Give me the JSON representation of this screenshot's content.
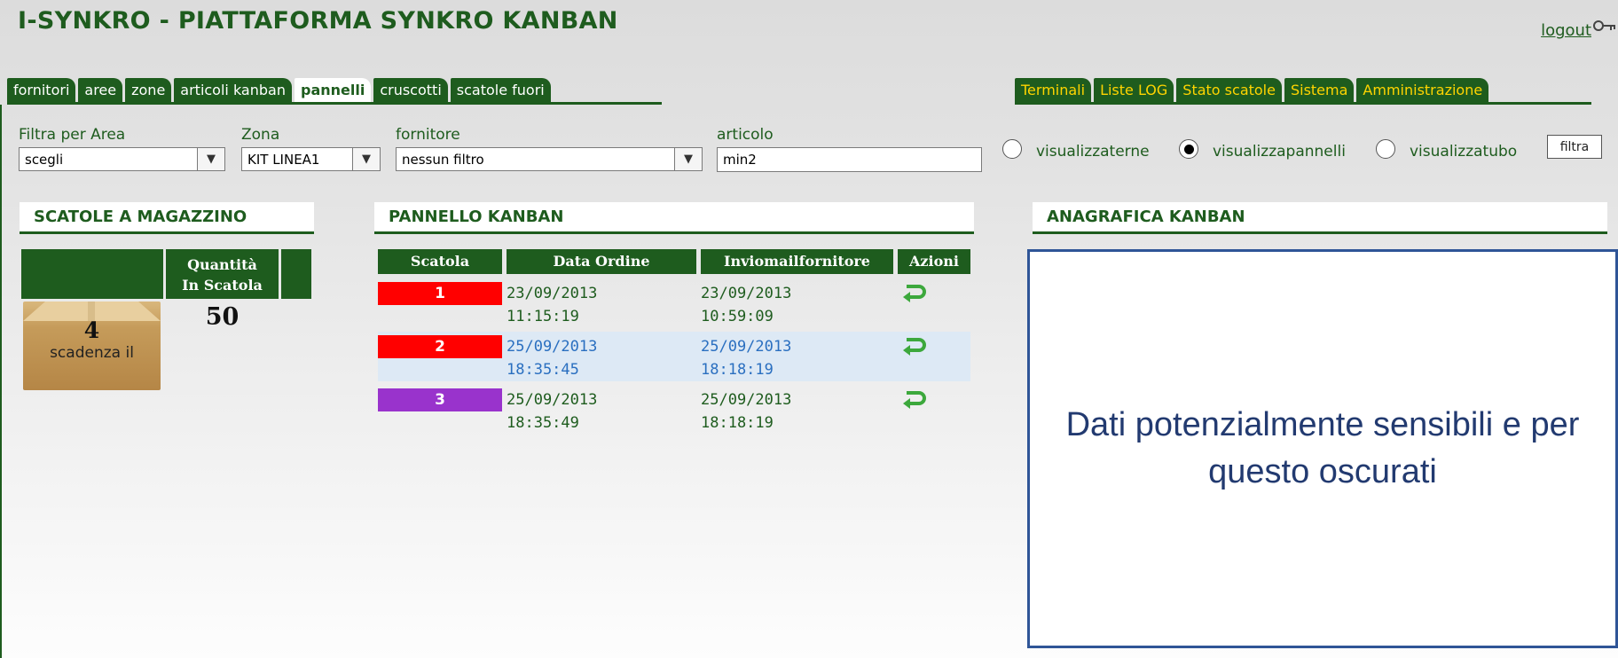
{
  "header": {
    "title": "I-SYNKRO - PIATTAFORMA SYNKRO KANBAN",
    "logout_label": "logout"
  },
  "tabs_left": [
    {
      "label": "fornitori",
      "active": false
    },
    {
      "label": "aree",
      "active": false
    },
    {
      "label": "zone",
      "active": false
    },
    {
      "label": "articoli kanban",
      "active": false
    },
    {
      "label": "pannelli",
      "active": true
    },
    {
      "label": "cruscotti",
      "active": false
    },
    {
      "label": "scatole fuori",
      "active": false
    }
  ],
  "tabs_right": [
    {
      "label": "Terminali"
    },
    {
      "label": "Liste LOG"
    },
    {
      "label": "Stato scatole"
    },
    {
      "label": "Sistema"
    },
    {
      "label": "Amministrazione"
    }
  ],
  "filters": {
    "area_label": "Filtra per Area",
    "area_value": "scegli",
    "zona_label": "Zona",
    "zona_value": "KIT LINEA1",
    "fornitore_label": "fornitore",
    "fornitore_value": "nessun filtro",
    "articolo_label": "articolo",
    "articolo_value": "min2",
    "radio_options": [
      {
        "label": "visualizzaterne",
        "checked": false
      },
      {
        "label": "visualizzapannelli",
        "checked": true
      },
      {
        "label": "visualizzatubo",
        "checked": false
      }
    ],
    "filtra_label": "filtra"
  },
  "scatole_magazzino": {
    "title": "SCATOLE A MAGAZZINO",
    "col_header": "Quantità\nIn Scatola",
    "box_count": "4",
    "box_caption": "scadenza il",
    "quantity": "50"
  },
  "pannello_kanban": {
    "title": "PANNELLO KANBAN",
    "columns": [
      "Scatola",
      "Data Ordine",
      "Inviomailfornitore",
      "Azioni"
    ],
    "rows": [
      {
        "scatola": "1",
        "color": "#ff0000",
        "data_ordine_date": "23/09/2013",
        "data_ordine_time": "11:15:19",
        "invio_date": "23/09/2013",
        "invio_time": "10:59:09",
        "highlight": false,
        "text_color": "#1e5c1e"
      },
      {
        "scatola": "2",
        "color": "#ff0000",
        "data_ordine_date": "25/09/2013",
        "data_ordine_time": "18:35:45",
        "invio_date": "25/09/2013",
        "invio_time": "18:18:19",
        "highlight": true,
        "text_color": "#2a6fc0"
      },
      {
        "scatola": "3",
        "color": "#9933cc",
        "data_ordine_date": "25/09/2013",
        "data_ordine_time": "18:35:49",
        "invio_date": "25/09/2013",
        "invio_time": "18:18:19",
        "highlight": false,
        "text_color": "#1e5c1e"
      }
    ]
  },
  "anagrafica": {
    "title": "ANAGRAFICA KANBAN",
    "overlay_text": "Dati potenzialmente sensibili e per questo oscurati"
  },
  "colors": {
    "brand_green": "#1e5c1e",
    "tab_right_text": "#ffd400",
    "overlay_border": "#2f5597"
  },
  "icons": {
    "logout": "key-icon",
    "azioni": "return-arrow-icon"
  }
}
